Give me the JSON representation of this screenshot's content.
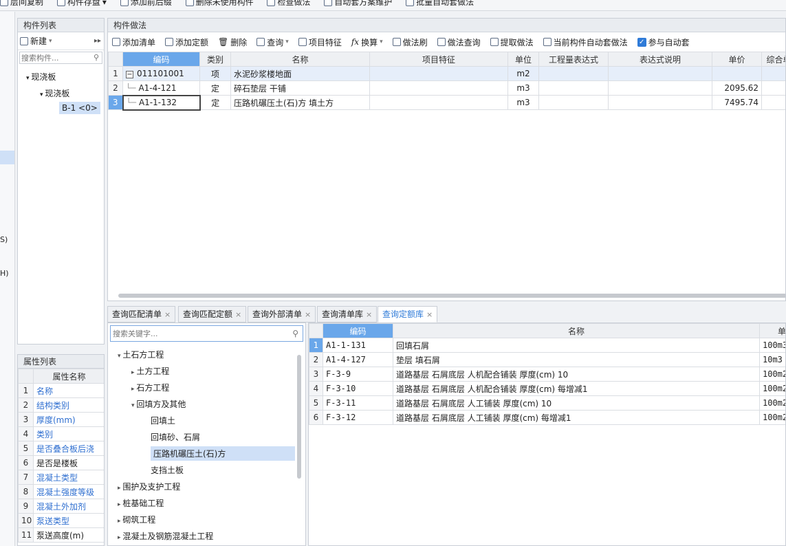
{
  "toolbar_top": {
    "items": [
      "层间复制",
      "构件存盘",
      "添加前后缀",
      "删除未使用构件",
      "检查做法",
      "自动套方案维护",
      "批量自动套做法"
    ]
  },
  "left_strip": {
    "glyph1": "S)",
    "glyph2": "H)"
  },
  "component_list": {
    "title": "构件列表",
    "new_label": "新建",
    "search_placeholder": "搜索构件...",
    "tree": [
      "现浇板",
      "现浇板",
      "B-1 <0>"
    ]
  },
  "property_list": {
    "title": "属性列表",
    "header": "属性名称",
    "rows": [
      {
        "num": "1",
        "name": "名称",
        "linked": true
      },
      {
        "num": "2",
        "name": "结构类别",
        "linked": true
      },
      {
        "num": "3",
        "name": "厚度(mm)",
        "linked": true
      },
      {
        "num": "4",
        "name": "类别",
        "linked": true
      },
      {
        "num": "5",
        "name": "是否叠合板后浇",
        "linked": true
      },
      {
        "num": "6",
        "name": "是否是楼板",
        "linked": false
      },
      {
        "num": "7",
        "name": "混凝土类型",
        "linked": true
      },
      {
        "num": "8",
        "name": "混凝土强度等级",
        "linked": true
      },
      {
        "num": "9",
        "name": "混凝土外加剂",
        "linked": true
      },
      {
        "num": "10",
        "name": "泵送类型",
        "linked": true
      },
      {
        "num": "11",
        "name": "泵送高度(m)",
        "linked": false
      }
    ]
  },
  "method_panel": {
    "title": "构件做法",
    "toolbar": [
      "添加清单",
      "添加定额",
      "删除",
      "查询",
      "项目特征",
      "换算",
      "做法刷",
      "做法查询",
      "提取做法",
      "当前构件自动套做法",
      "参与自动套"
    ],
    "columns": [
      "编码",
      "类别",
      "名称",
      "项目特征",
      "单位",
      "工程量表达式",
      "表达式说明",
      "单价",
      "综合单"
    ],
    "rows": [
      {
        "num": "1",
        "code": "011101001",
        "type": "项",
        "name": "水泥砂浆楼地面",
        "feature": "",
        "unit": "m2",
        "expr": "",
        "desc": "",
        "price": ""
      },
      {
        "num": "2",
        "code": "A1-4-121",
        "type": "定",
        "name": "碎石垫层 干铺",
        "feature": "",
        "unit": "m3",
        "expr": "",
        "desc": "",
        "price": "2095.62"
      },
      {
        "num": "3",
        "code": "A1-1-132",
        "type": "定",
        "name": "压路机碾压土(石)方 填土方",
        "feature": "",
        "unit": "m3",
        "expr": "",
        "desc": "",
        "price": "7495.74"
      }
    ]
  },
  "bottom_tabs": [
    "查询匹配清单",
    "查询匹配定额",
    "查询外部清单",
    "查询清单库",
    "查询定额库"
  ],
  "quota_search": {
    "placeholder": "搜索关键字...",
    "tree": [
      "土石方工程",
      "土方工程",
      "石方工程",
      "回填方及其他",
      "回填土",
      "回填砂、石屑",
      "压路机碾压土(石)方",
      "支挡土板",
      "围护及支护工程",
      "桩基础工程",
      "砌筑工程",
      "混凝土及钢筋混凝土工程"
    ]
  },
  "quota_table": {
    "columns": [
      "编码",
      "名称",
      "单"
    ],
    "rows": [
      {
        "num": "1",
        "code": "A1-1-131",
        "name": "回填石屑",
        "unit": "100m3"
      },
      {
        "num": "2",
        "code": "A1-4-127",
        "name": "垫层 填石屑",
        "unit": "10m3"
      },
      {
        "num": "3",
        "code": "F-3-9",
        "name": "道路基层 石屑底层 人机配合铺装 厚度(cm) 10",
        "unit": "100m2"
      },
      {
        "num": "4",
        "code": "F-3-10",
        "name": "道路基层 石屑底层 人机配合铺装 厚度(cm) 每增减1",
        "unit": "100m2"
      },
      {
        "num": "5",
        "code": "F-3-11",
        "name": "道路基层 石屑底层 人工铺装 厚度(cm) 10",
        "unit": "100m2"
      },
      {
        "num": "6",
        "code": "F-3-12",
        "name": "道路基层 石屑底层 人工铺装 厚度(cm) 每增减1",
        "unit": "100m2"
      }
    ]
  },
  "colors": {
    "accent": "#6aa7ea",
    "link": "#2f6fd0",
    "selection": "#cfe0f7"
  }
}
